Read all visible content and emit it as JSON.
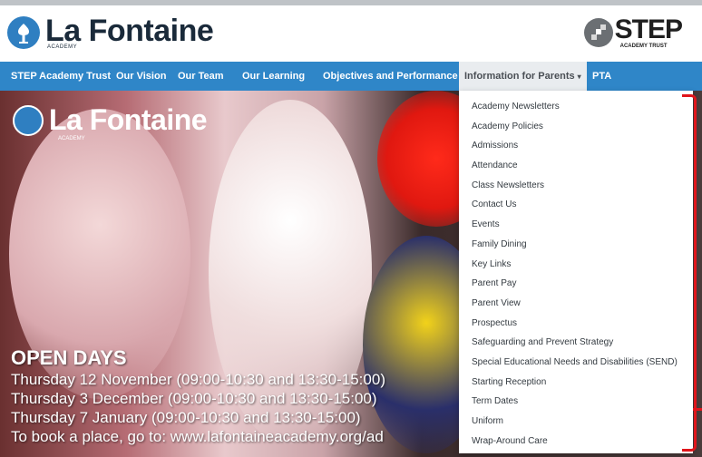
{
  "header": {
    "logo_title": "La Fontaine",
    "logo_sub": "ACADEMY",
    "step_title": "STEP",
    "step_sub": "ACADEMY TRUST"
  },
  "nav": {
    "items": [
      {
        "label": "STEP Academy Trust"
      },
      {
        "label": "Our Vision"
      },
      {
        "label": "Our Team"
      },
      {
        "label": "Our Learning"
      },
      {
        "label": "Objectives and Performance"
      },
      {
        "label": "Information for Parents"
      },
      {
        "label": "PTA"
      }
    ],
    "caret": "▾"
  },
  "hero": {
    "logo_title": "La Fontaine",
    "logo_sub": "ACADEMY",
    "open_days_title": "OPEN DAYS",
    "lines": [
      "Thursday 12 November (09:00-10:30 and 13:30-15:00)",
      "Thursday 3 December (09:00-10:30 and 13:30-15:00)",
      "Thursday 7 January (09:00-10:30 and 13:30-15:00)",
      "To book a place, go to: www.lafontaineacademy.org/ad"
    ]
  },
  "dropdown": {
    "items": [
      "Academy Newsletters",
      "Academy Policies",
      "Admissions",
      "Attendance",
      "Class Newsletters",
      "Contact Us",
      "Events",
      "Family Dining",
      "Key Links",
      "Parent Pay",
      "Parent View",
      "Prospectus",
      "Safeguarding and Prevent Strategy",
      "Special Educational Needs and Disabilities (SEND)",
      "Starting Reception",
      "Term Dates",
      "Uniform",
      "Wrap-Around Care"
    ]
  },
  "colors": {
    "nav_bg": "#2f86c8",
    "brand_blue": "#2f7fc1",
    "annotation_red": "#e0151b"
  }
}
